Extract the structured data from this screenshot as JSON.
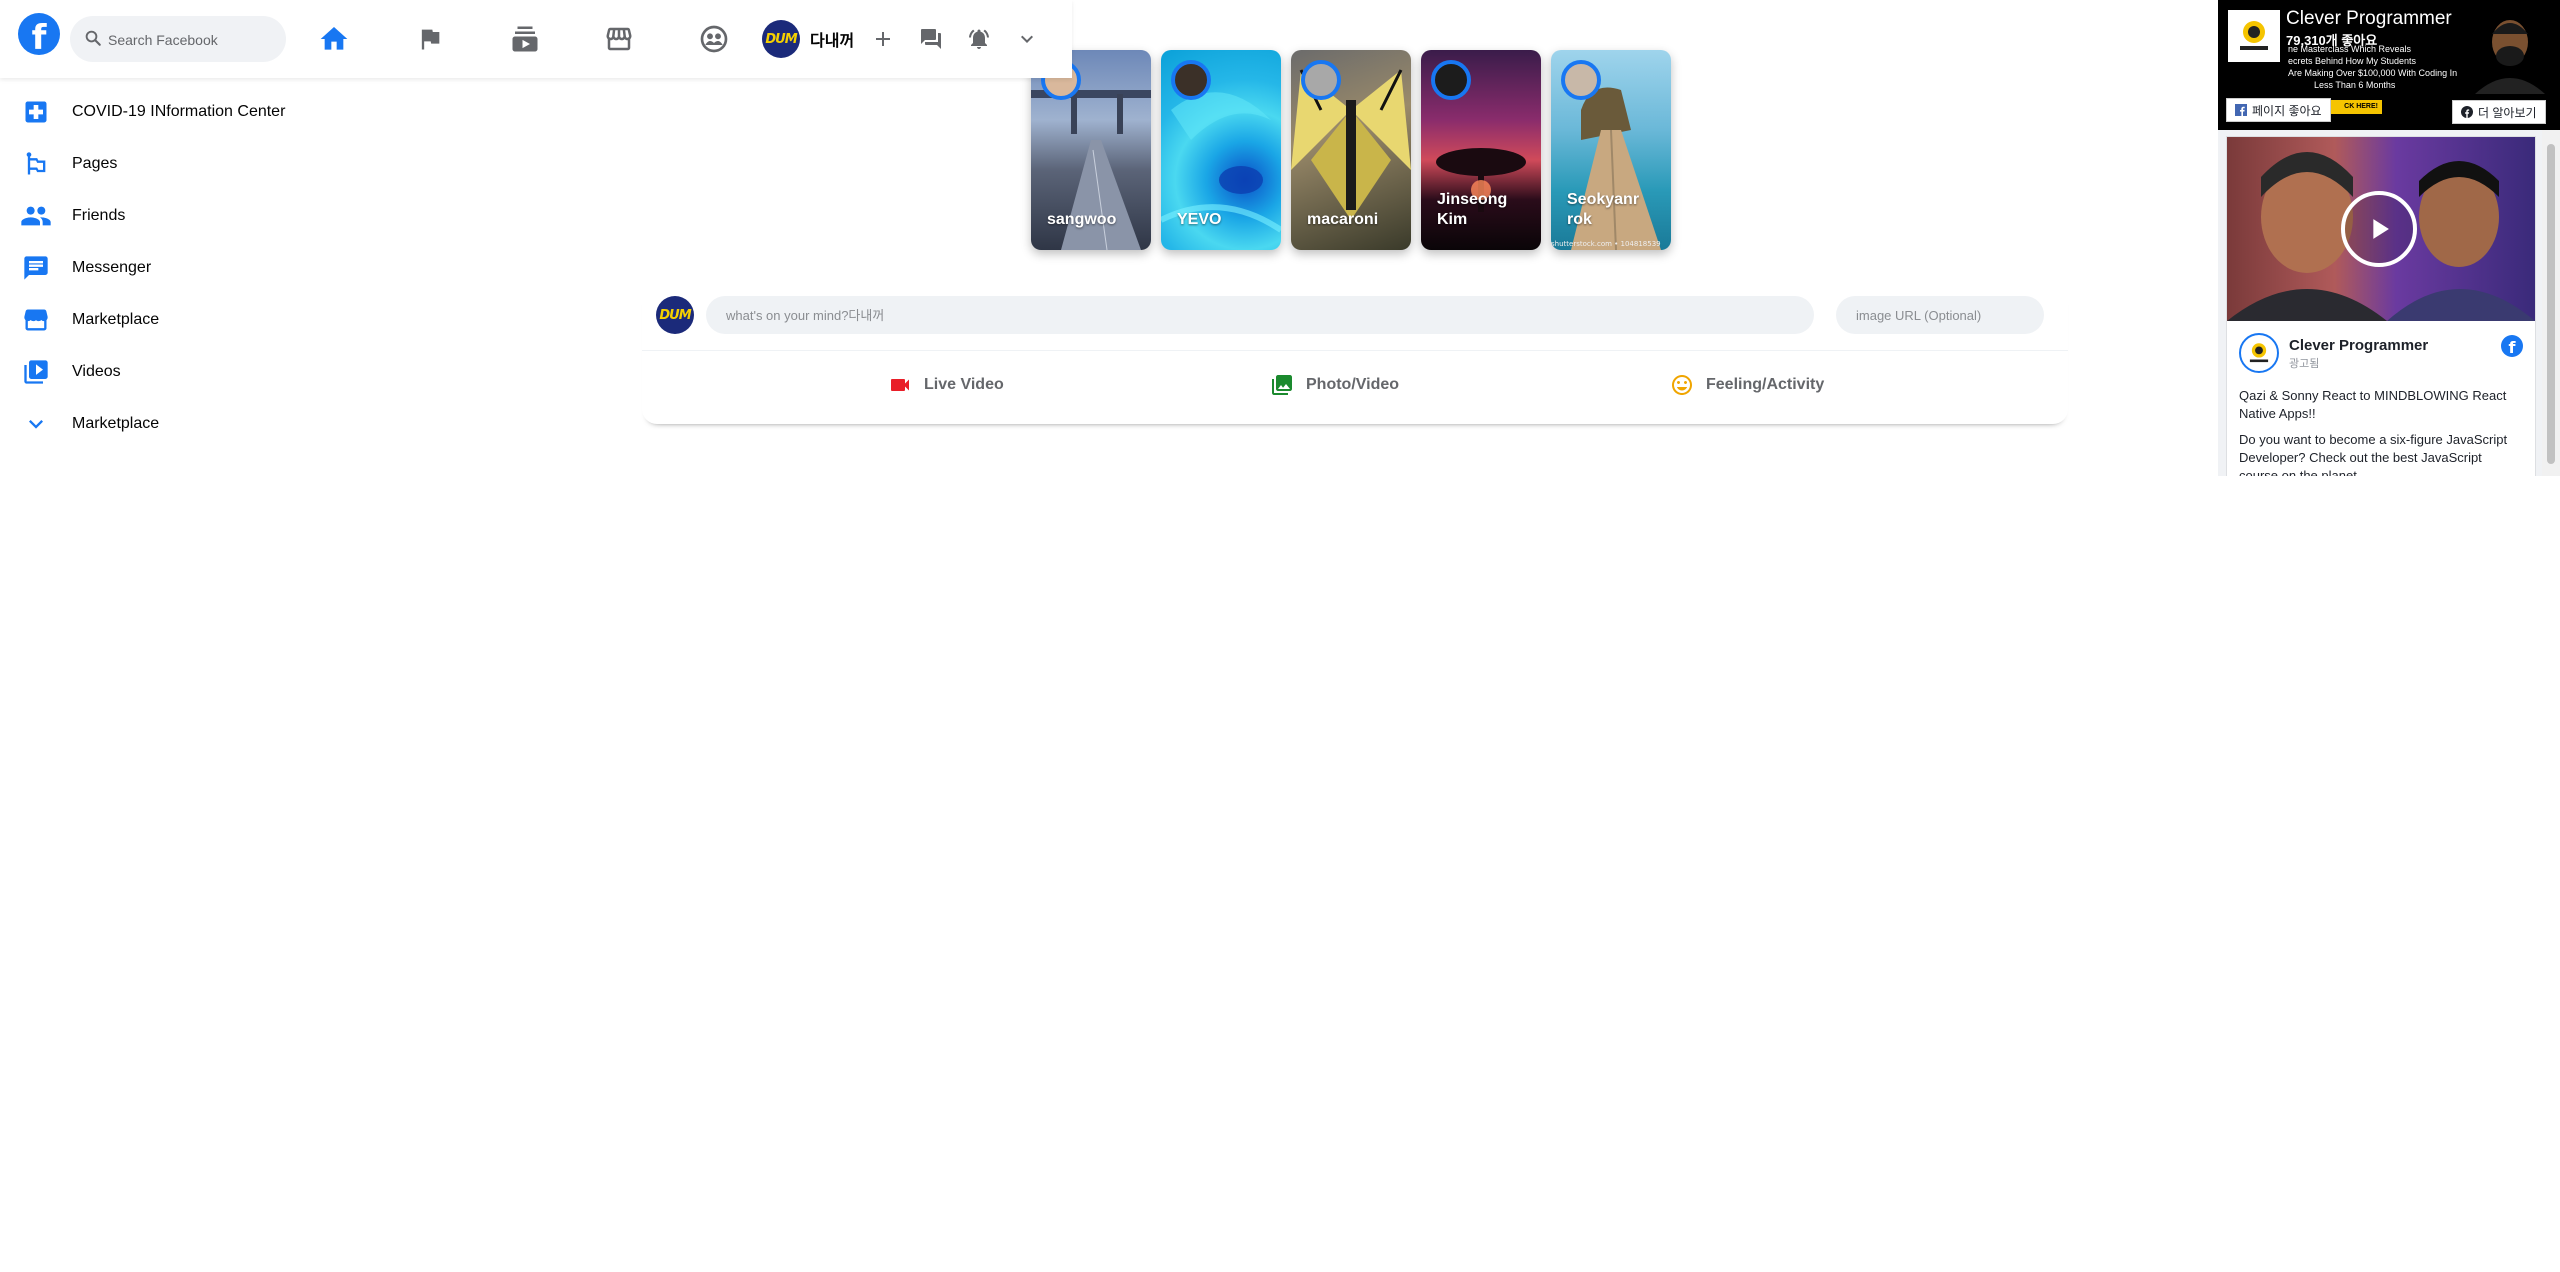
{
  "header": {
    "logo_letter": "f",
    "search_placeholder": "Search Facebook",
    "profile_name": "다내꺼",
    "avatar_text": "DUM"
  },
  "nav_icons": [
    "home-icon",
    "flag-icon",
    "subscriptions-icon",
    "storefront-icon",
    "supervised-account-icon"
  ],
  "header_actions": [
    "add-icon",
    "forum-icon",
    "notifications-active-icon",
    "expand-more-icon"
  ],
  "accent_color": "#1877f2",
  "sidebar": {
    "items": [
      {
        "label": "COVID-19 INformation Center",
        "icon": "local-hospital-icon"
      },
      {
        "label": "Pages",
        "icon": "emoji-flags-icon"
      },
      {
        "label": "Friends",
        "icon": "people-icon"
      },
      {
        "label": "Messenger",
        "icon": "chat-icon"
      },
      {
        "label": "Marketplace",
        "icon": "storefront-icon"
      },
      {
        "label": "Videos",
        "icon": "video-library-icon"
      },
      {
        "label": "Marketplace",
        "icon": "expand-more-icon"
      }
    ]
  },
  "stories": [
    {
      "name": "sangwoo"
    },
    {
      "name": "YEVO"
    },
    {
      "name": "macaroni"
    },
    {
      "name": "Jinseong Kim"
    },
    {
      "name": "Seokyanr rok",
      "watermark": "shutterstock.com • 104818539"
    }
  ],
  "composer": {
    "message_placeholder": "what's on your mind?다내꺼",
    "image_url_placeholder": "image URL (Optional)",
    "actions": [
      {
        "label": "Live Video",
        "color": "#f3425f",
        "icon": "videocam-icon"
      },
      {
        "label": "Photo/Video",
        "color": "#45bd62",
        "icon": "photo-library-icon"
      },
      {
        "label": "Feeling/Activity",
        "color": "#f7b928",
        "icon": "insert-emoticon-icon"
      }
    ]
  },
  "widget": {
    "page_name": "Clever Programmer",
    "likes": "79,310개 좋아요",
    "banner_lines": [
      "ne Masterclass Which Reveals",
      "ecrets Behind How My Students",
      "Are Making Over $100,000 With Coding In",
      "Less Than 6 Months"
    ],
    "banner_cta": "CK HERE!",
    "like_button": "페이지 좋아요",
    "learn_more_button": "더 알아보기",
    "post_author": "Clever Programmer",
    "post_sub": "광고됨",
    "post_text_1": "Qazi & Sonny React to MINDBLOWING React Native Apps!!",
    "post_text_2": "Do you want to become a six-figure JavaScript Developer? Check out the best JavaScript course on the planet"
  }
}
